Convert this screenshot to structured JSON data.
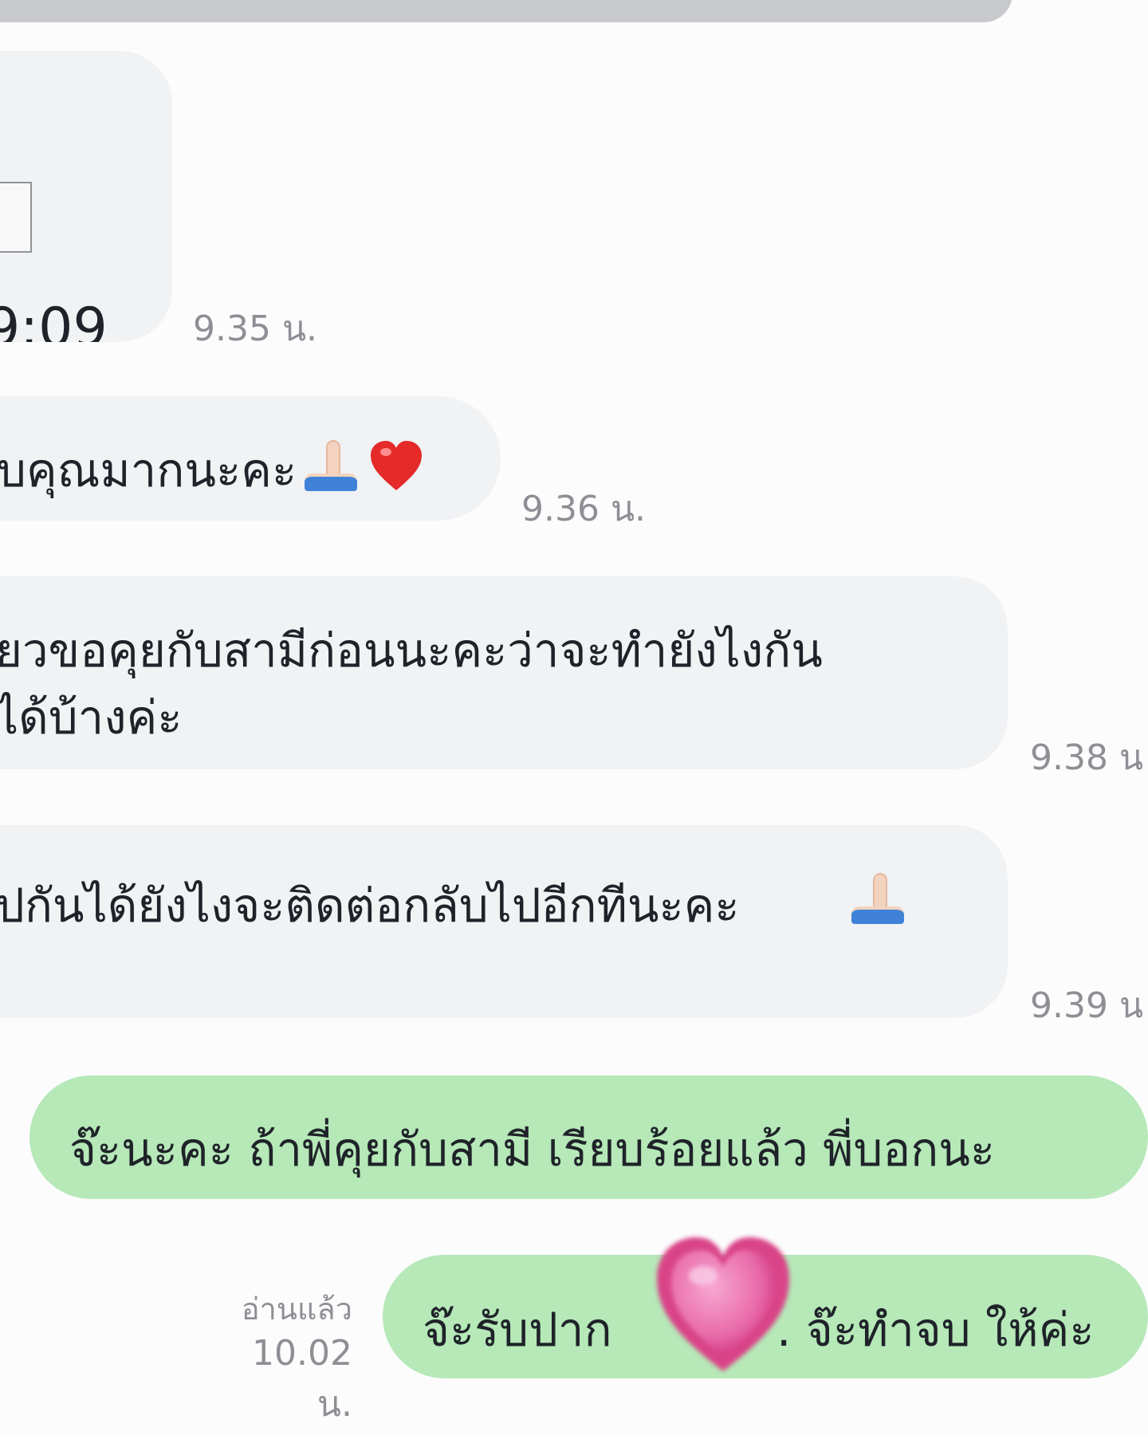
{
  "messages": [
    {
      "id": "msg-1",
      "type": "incoming",
      "lines": [
        "9:09"
      ],
      "time": "9.35 น."
    },
    {
      "id": "msg-2",
      "type": "incoming",
      "lines": [
        "บคุณมากนะคะ"
      ],
      "time": "9.36 น."
    },
    {
      "id": "msg-3",
      "type": "incoming",
      "lines": [
        "ยวขอคุยกับสามีก่อนนะคะว่าจะทำยังไงกัน",
        "ได้บ้างค่ะ"
      ],
      "time": "9.38 น"
    },
    {
      "id": "msg-4",
      "type": "incoming",
      "lines": [
        "ปกันได้ยังไงจะติดต่อกลับไปอีกทีนะคะ"
      ],
      "time": "9.39 น"
    },
    {
      "id": "msg-5",
      "type": "outgoing",
      "lines": [
        "จ๊ะนะคะ ถ้าพี่คุยกับสามี เรียบร้อยแล้ว พี่บอกนะ"
      ]
    },
    {
      "id": "msg-6",
      "type": "outgoing",
      "parts": [
        "จ๊ะรับปาก",
        ". จ๊ะทำจบ ให้ค่ะ"
      ],
      "read": "อ่านแล้ว",
      "time": "10.02 น."
    }
  ],
  "icons": {
    "placeholder": "image-placeholder-icon",
    "pray": "praying-hands-icon",
    "heart": "heart-icon",
    "sticker": "blurred-heart-sticker-icon"
  },
  "colors": {
    "incoming_bubble": "#f0f2f4",
    "outgoing_bubble": "#b6e8b8",
    "time_text": "#8d8f94",
    "text": "#1f2329",
    "top_bar": "#c8c9cc"
  }
}
